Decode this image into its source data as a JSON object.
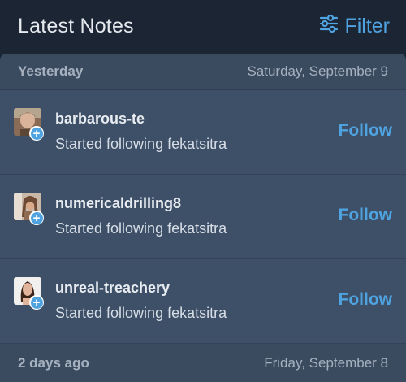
{
  "header": {
    "title": "Latest Notes",
    "filter_label": "Filter",
    "filter_icon": "sliders-icon",
    "accent_color": "#4fa3e0"
  },
  "groups": [
    {
      "relative": "Yesterday",
      "date": "Saturday, September 9",
      "notes": [
        {
          "username": "barbarous-te",
          "text": "Started following fekatsitra",
          "action": "Follow"
        },
        {
          "username": "numericaldrilling8",
          "text": "Started following fekatsitra",
          "action": "Follow"
        },
        {
          "username": "unreal-treachery",
          "text": "Started following fekatsitra",
          "action": "Follow"
        }
      ]
    },
    {
      "relative": "2 days ago",
      "date": "Friday, September 8",
      "notes": []
    }
  ]
}
